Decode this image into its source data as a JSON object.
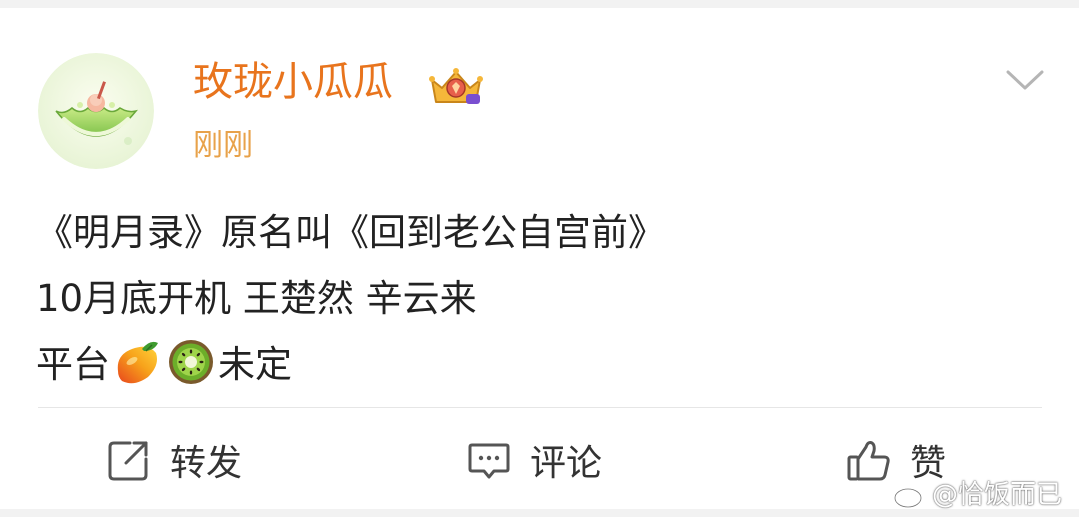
{
  "post": {
    "username": "玫珑小瓜瓜",
    "timestamp": "刚刚",
    "content_lines": [
      "《明月录》原名叫《回到老公自宫前》",
      "10月底开机 王楚然 辛云来"
    ],
    "line3_prefix": "平台",
    "line3_emojis": [
      "mango-emoji",
      "kiwi-emoji"
    ],
    "line3_suffix": "未定"
  },
  "actions": {
    "repost_label": "转发",
    "comment_label": "评论",
    "like_label": "赞"
  },
  "watermark": {
    "text": "@恰饭而已"
  },
  "icons": {
    "avatar": "melon-avatar",
    "badge": "vip-crown-badge",
    "menu": "chevron-down-icon",
    "repost": "repost-icon",
    "comment": "comment-icon",
    "like": "thumbs-up-icon",
    "watermark_logo": "weibo-logo-icon"
  },
  "colors": {
    "username": "#e8741d",
    "timestamp": "#e8a24a",
    "text": "#222222",
    "action_text": "#333333"
  }
}
